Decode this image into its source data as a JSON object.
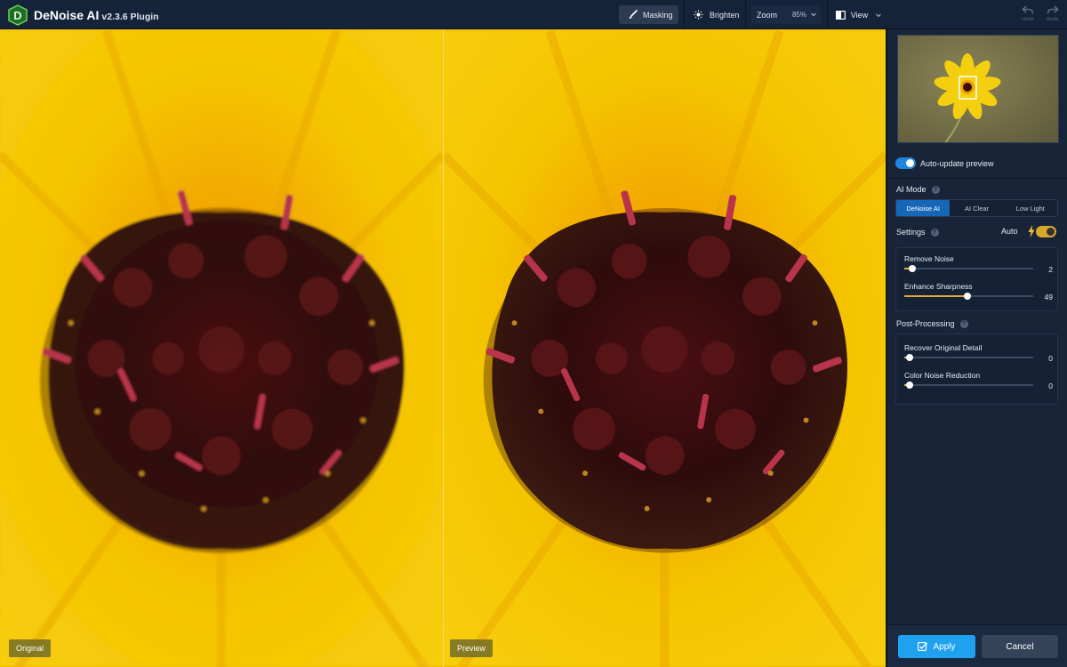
{
  "app": {
    "title": "DeNoise AI",
    "version": "v2.3.6 Plugin"
  },
  "toolbar": {
    "masking_label": "Masking",
    "brighten_label": "Brighten",
    "zoom_label": "Zoom",
    "zoom_value": "85%",
    "view_label": "View",
    "undo_label": "Undo",
    "redo_label": "Redo"
  },
  "viewer": {
    "left_tag": "Original",
    "right_tag": "Preview"
  },
  "panel": {
    "auto_update_label": "Auto-update preview",
    "auto_update_on": true,
    "ai_mode_title": "AI Mode",
    "modes": [
      "DeNoise AI",
      "AI Clear",
      "Low Light"
    ],
    "active_mode": "DeNoise AI",
    "settings_title": "Settings",
    "auto_label": "Auto",
    "settings": [
      {
        "label": "Remove Noise",
        "value": "2",
        "level": 0.06
      },
      {
        "label": "Enhance Sharpness",
        "value": "49",
        "level": 0.49
      }
    ],
    "post_title": "Post-Processing",
    "post": [
      {
        "label": "Recover Original Detail",
        "value": "0",
        "level": 0.04
      },
      {
        "label": "Color Noise Reduction",
        "value": "0",
        "level": 0.04
      }
    ],
    "apply_label": "Apply",
    "cancel_label": "Cancel"
  },
  "colors": {
    "accent": "#1ea2f0",
    "mode_active": "#1767b8",
    "slider_fill": "#e3a53a",
    "auto_toggle": "#d8a828",
    "petal_yellow": "#f2c100"
  }
}
